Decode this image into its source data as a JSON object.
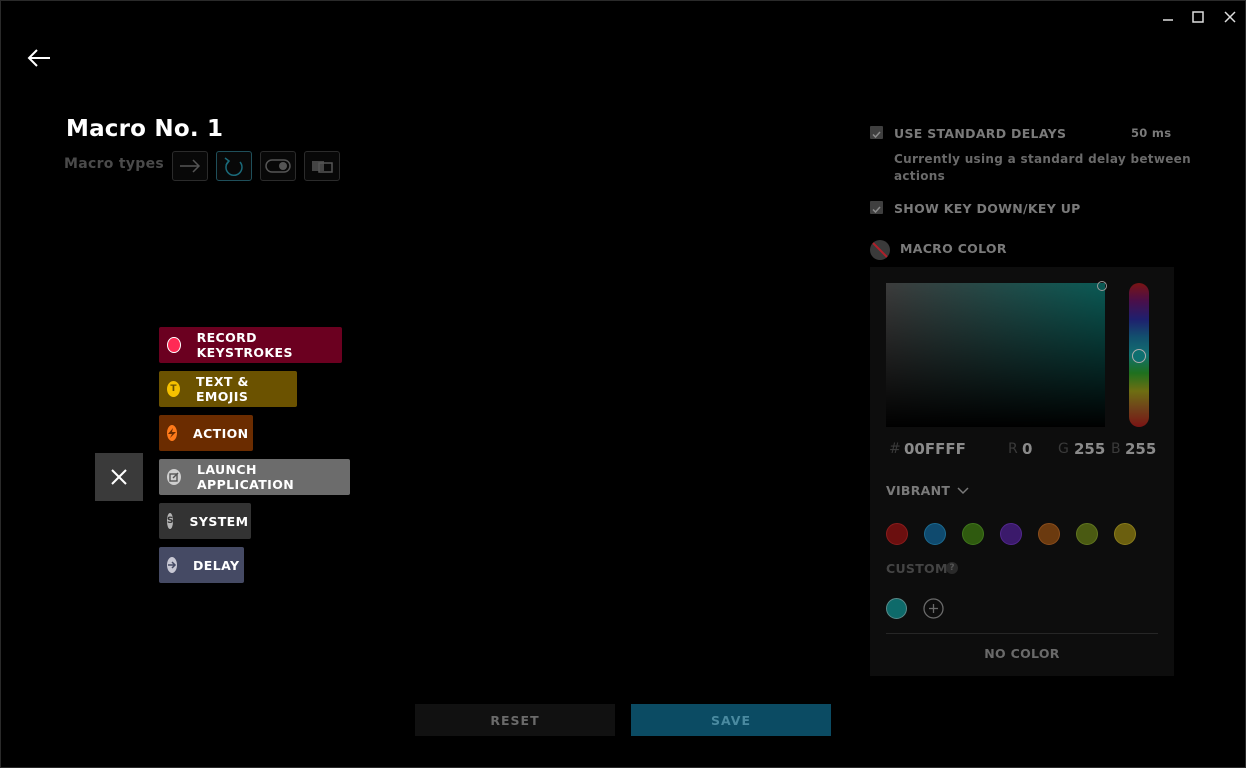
{
  "window": {
    "minimize": "—",
    "maximize": "☐",
    "close": "✕"
  },
  "macro": {
    "title": "Macro No. 1",
    "types_label": "Macro types"
  },
  "actions": [
    {
      "label": "RECORD KEYSTROKES",
      "icon": "record-icon",
      "color": "#6b0020"
    },
    {
      "label": "TEXT & EMOJIS",
      "icon": "text-icon",
      "icon_glyph": "T",
      "color": "#6b5200"
    },
    {
      "label": "ACTION",
      "icon": "lightning-icon",
      "color": "#6b2c00"
    },
    {
      "label": "LAUNCH APPLICATION",
      "icon": "launch-icon",
      "color": "#6c6c6c"
    },
    {
      "label": "SYSTEM",
      "icon": "system-icon",
      "icon_glyph": "S",
      "color": "#333333"
    },
    {
      "label": "DELAY",
      "icon": "arrow-right-icon",
      "color": "#454a64"
    }
  ],
  "settings": {
    "standard_delays_label": "USE STANDARD DELAYS",
    "standard_delays_value": "50 ms",
    "standard_delays_desc_1": "Currently using a standard delay between",
    "standard_delays_desc_2": "actions",
    "key_down_up_label": "SHOW KEY DOWN/KEY UP",
    "macro_color_label": "MACRO COLOR"
  },
  "color_picker": {
    "hash": "#",
    "hex": "00FFFF",
    "r_label": "R",
    "r": "0",
    "g_label": "G",
    "g": "255",
    "b_label": "B",
    "b": "255",
    "palette_label": "VIBRANT",
    "custom_label": "CUSTOM",
    "help": "?",
    "no_color": "NO COLOR",
    "swatches": [
      "#6b0f0f",
      "#0f4a6e",
      "#2f5a0f",
      "#3b1a6b",
      "#6b3a0f",
      "#4a5a12",
      "#6b5f0f"
    ],
    "custom_swatch": "#0e6a6a"
  },
  "footer": {
    "reset": "RESET",
    "save": "SAVE"
  }
}
